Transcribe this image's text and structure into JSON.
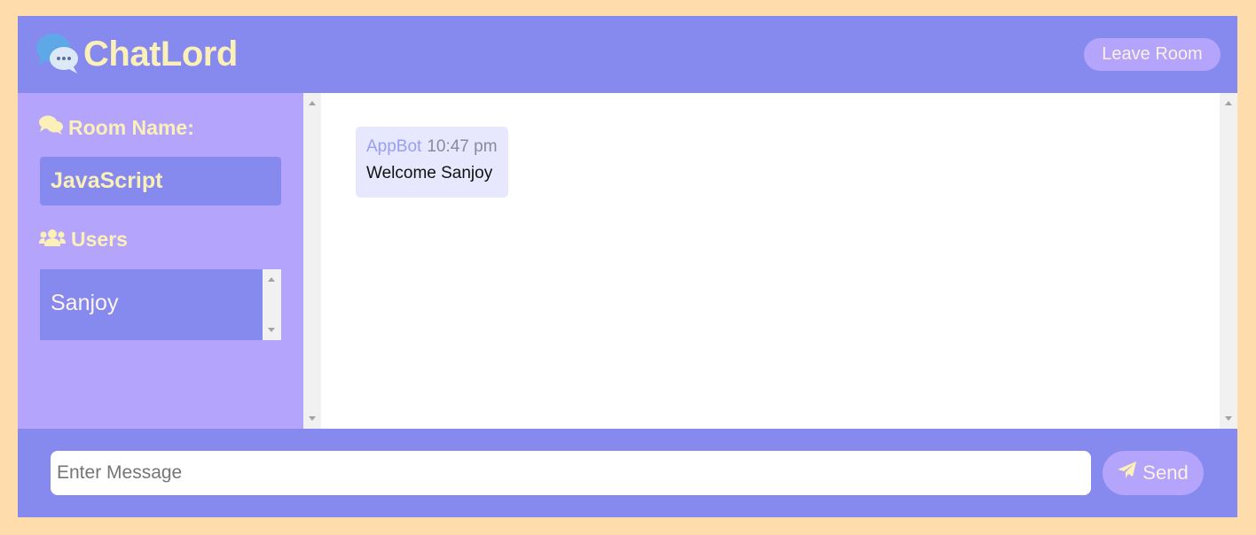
{
  "header": {
    "logo_text": "ChatLord",
    "logo_icon": "chat-bubbles-icon",
    "leave_label": "Leave Room"
  },
  "sidebar": {
    "room_heading": "Room Name:",
    "room_heading_icon": "comments-icon",
    "room_name": "JavaScript",
    "users_heading": "Users",
    "users_heading_icon": "users-icon",
    "users": [
      "Sanjoy"
    ]
  },
  "chat": {
    "messages": [
      {
        "author": "AppBot",
        "time": "10:47 pm",
        "text": "Welcome Sanjoy"
      }
    ]
  },
  "footer": {
    "input_placeholder": "Enter Message",
    "input_value": "",
    "send_label": "Send",
    "send_icon": "paper-plane-icon"
  },
  "colors": {
    "page_bg": "#ffdcab",
    "primary": "#868aee",
    "secondary": "#b4a4fc",
    "accent_text": "#fbf0b8",
    "message_bg": "#e7e8fd"
  }
}
